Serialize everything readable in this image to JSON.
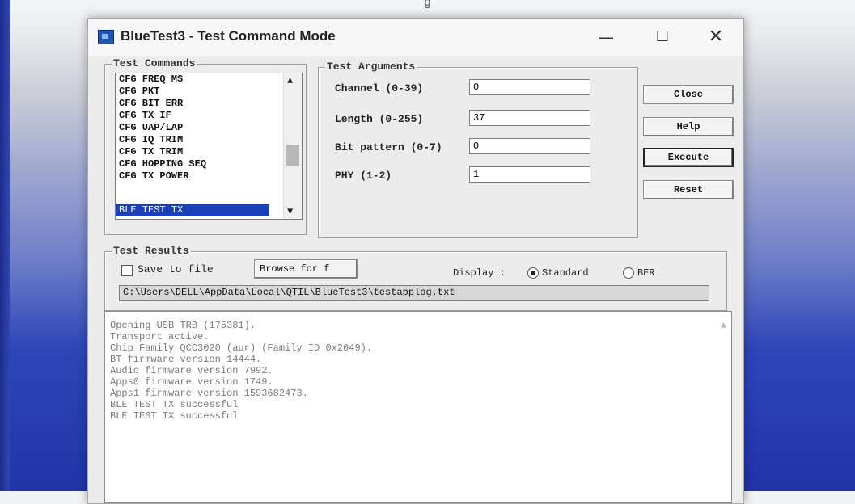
{
  "caption": "g",
  "window": {
    "title": "BlueTest3 - Test Command Mode",
    "minimize": "—",
    "maximize": "☐",
    "close": "✕"
  },
  "commands": {
    "label": "Test Commands",
    "items": [
      "CFG FREQ MS",
      "CFG PKT",
      "CFG BIT ERR",
      "CFG TX IF",
      "CFG UAP/LAP",
      "CFG IQ TRIM",
      "CFG TX TRIM",
      "CFG HOPPING SEQ",
      "CFG TX POWER"
    ],
    "selected": "BLE TEST TX"
  },
  "arguments": {
    "label": "Test Arguments",
    "fields": [
      {
        "label": "Channel (0-39)",
        "value": "0"
      },
      {
        "label": "Length (0-255)",
        "value": "37"
      },
      {
        "label": "Bit pattern (0-7)",
        "value": "0"
      },
      {
        "label": "PHY (1-2)",
        "value": "1"
      }
    ]
  },
  "buttons": {
    "close": "Close",
    "help": "Help",
    "execute": "Execute",
    "reset": "Reset"
  },
  "results": {
    "label": "Test Results",
    "save_to_file": "Save to file",
    "browse": "Browse for f",
    "display_label": "Display :",
    "radio_standard": "Standard",
    "radio_ber": "BER",
    "selected_display": "Standard",
    "path": "C:\\Users\\DELL\\AppData\\Local\\QTIL\\BlueTest3\\testapplog.txt"
  },
  "log": [
    "Opening USB TRB (175381).",
    "Transport active.",
    "Chip Family QCC3020 (aur) (Family ID 0x2049).",
    "BT firmware version 14444.",
    "Audio firmware version 7992.",
    "Apps0 firmware version 1749.",
    "Apps1 firmware version 1593682473.",
    "BLE TEST TX successful",
    "BLE TEST TX successful"
  ]
}
